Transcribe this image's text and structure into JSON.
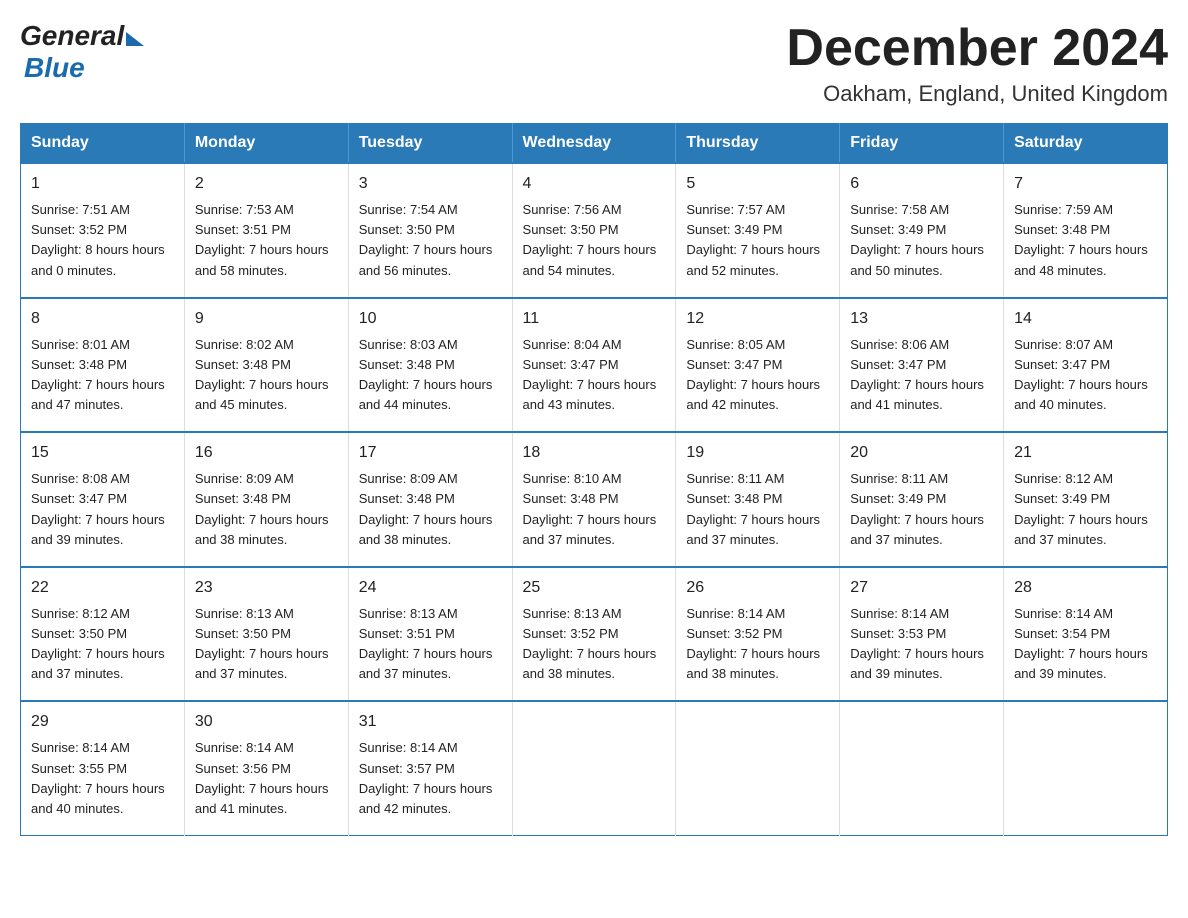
{
  "logo": {
    "general": "General",
    "blue": "Blue"
  },
  "title": "December 2024",
  "location": "Oakham, England, United Kingdom",
  "weekdays": [
    "Sunday",
    "Monday",
    "Tuesday",
    "Wednesday",
    "Thursday",
    "Friday",
    "Saturday"
  ],
  "weeks": [
    [
      {
        "day": "1",
        "sunrise": "7:51 AM",
        "sunset": "3:52 PM",
        "daylight": "8 hours and 0 minutes."
      },
      {
        "day": "2",
        "sunrise": "7:53 AM",
        "sunset": "3:51 PM",
        "daylight": "7 hours and 58 minutes."
      },
      {
        "day": "3",
        "sunrise": "7:54 AM",
        "sunset": "3:50 PM",
        "daylight": "7 hours and 56 minutes."
      },
      {
        "day": "4",
        "sunrise": "7:56 AM",
        "sunset": "3:50 PM",
        "daylight": "7 hours and 54 minutes."
      },
      {
        "day": "5",
        "sunrise": "7:57 AM",
        "sunset": "3:49 PM",
        "daylight": "7 hours and 52 minutes."
      },
      {
        "day": "6",
        "sunrise": "7:58 AM",
        "sunset": "3:49 PM",
        "daylight": "7 hours and 50 minutes."
      },
      {
        "day": "7",
        "sunrise": "7:59 AM",
        "sunset": "3:48 PM",
        "daylight": "7 hours and 48 minutes."
      }
    ],
    [
      {
        "day": "8",
        "sunrise": "8:01 AM",
        "sunset": "3:48 PM",
        "daylight": "7 hours and 47 minutes."
      },
      {
        "day": "9",
        "sunrise": "8:02 AM",
        "sunset": "3:48 PM",
        "daylight": "7 hours and 45 minutes."
      },
      {
        "day": "10",
        "sunrise": "8:03 AM",
        "sunset": "3:48 PM",
        "daylight": "7 hours and 44 minutes."
      },
      {
        "day": "11",
        "sunrise": "8:04 AM",
        "sunset": "3:47 PM",
        "daylight": "7 hours and 43 minutes."
      },
      {
        "day": "12",
        "sunrise": "8:05 AM",
        "sunset": "3:47 PM",
        "daylight": "7 hours and 42 minutes."
      },
      {
        "day": "13",
        "sunrise": "8:06 AM",
        "sunset": "3:47 PM",
        "daylight": "7 hours and 41 minutes."
      },
      {
        "day": "14",
        "sunrise": "8:07 AM",
        "sunset": "3:47 PM",
        "daylight": "7 hours and 40 minutes."
      }
    ],
    [
      {
        "day": "15",
        "sunrise": "8:08 AM",
        "sunset": "3:47 PM",
        "daylight": "7 hours and 39 minutes."
      },
      {
        "day": "16",
        "sunrise": "8:09 AM",
        "sunset": "3:48 PM",
        "daylight": "7 hours and 38 minutes."
      },
      {
        "day": "17",
        "sunrise": "8:09 AM",
        "sunset": "3:48 PM",
        "daylight": "7 hours and 38 minutes."
      },
      {
        "day": "18",
        "sunrise": "8:10 AM",
        "sunset": "3:48 PM",
        "daylight": "7 hours and 37 minutes."
      },
      {
        "day": "19",
        "sunrise": "8:11 AM",
        "sunset": "3:48 PM",
        "daylight": "7 hours and 37 minutes."
      },
      {
        "day": "20",
        "sunrise": "8:11 AM",
        "sunset": "3:49 PM",
        "daylight": "7 hours and 37 minutes."
      },
      {
        "day": "21",
        "sunrise": "8:12 AM",
        "sunset": "3:49 PM",
        "daylight": "7 hours and 37 minutes."
      }
    ],
    [
      {
        "day": "22",
        "sunrise": "8:12 AM",
        "sunset": "3:50 PM",
        "daylight": "7 hours and 37 minutes."
      },
      {
        "day": "23",
        "sunrise": "8:13 AM",
        "sunset": "3:50 PM",
        "daylight": "7 hours and 37 minutes."
      },
      {
        "day": "24",
        "sunrise": "8:13 AM",
        "sunset": "3:51 PM",
        "daylight": "7 hours and 37 minutes."
      },
      {
        "day": "25",
        "sunrise": "8:13 AM",
        "sunset": "3:52 PM",
        "daylight": "7 hours and 38 minutes."
      },
      {
        "day": "26",
        "sunrise": "8:14 AM",
        "sunset": "3:52 PM",
        "daylight": "7 hours and 38 minutes."
      },
      {
        "day": "27",
        "sunrise": "8:14 AM",
        "sunset": "3:53 PM",
        "daylight": "7 hours and 39 minutes."
      },
      {
        "day": "28",
        "sunrise": "8:14 AM",
        "sunset": "3:54 PM",
        "daylight": "7 hours and 39 minutes."
      }
    ],
    [
      {
        "day": "29",
        "sunrise": "8:14 AM",
        "sunset": "3:55 PM",
        "daylight": "7 hours and 40 minutes."
      },
      {
        "day": "30",
        "sunrise": "8:14 AM",
        "sunset": "3:56 PM",
        "daylight": "7 hours and 41 minutes."
      },
      {
        "day": "31",
        "sunrise": "8:14 AM",
        "sunset": "3:57 PM",
        "daylight": "7 hours and 42 minutes."
      },
      null,
      null,
      null,
      null
    ]
  ]
}
